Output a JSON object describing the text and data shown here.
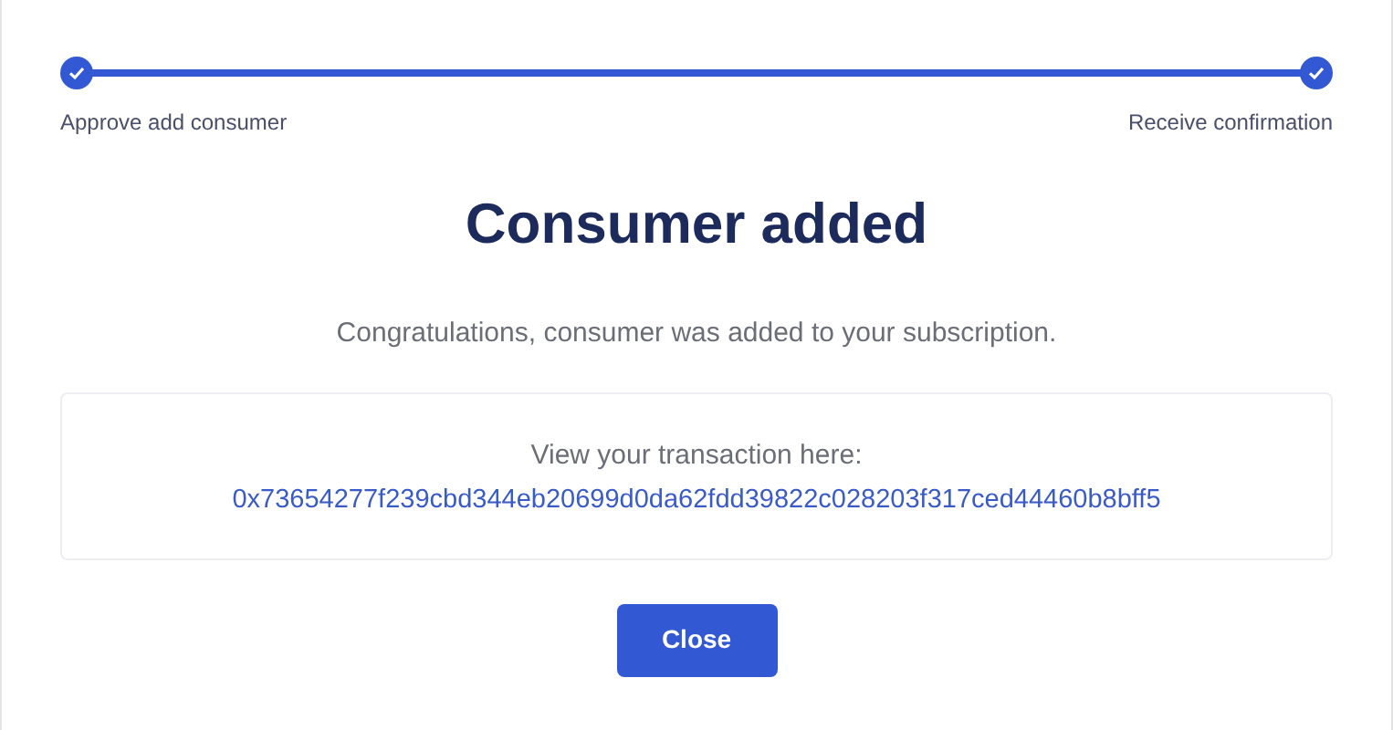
{
  "steps": [
    {
      "label": "Approve add consumer",
      "completed": true
    },
    {
      "label": "Receive confirmation",
      "completed": true
    }
  ],
  "title": "Consumer added",
  "message": "Congratulations, consumer was added to your subscription.",
  "transaction": {
    "label": "View your transaction here:",
    "hash": "0x73654277f239cbd344eb20699d0da62fdd39822c028203f317ced44460b8bff5"
  },
  "buttons": [
    "Close"
  ]
}
